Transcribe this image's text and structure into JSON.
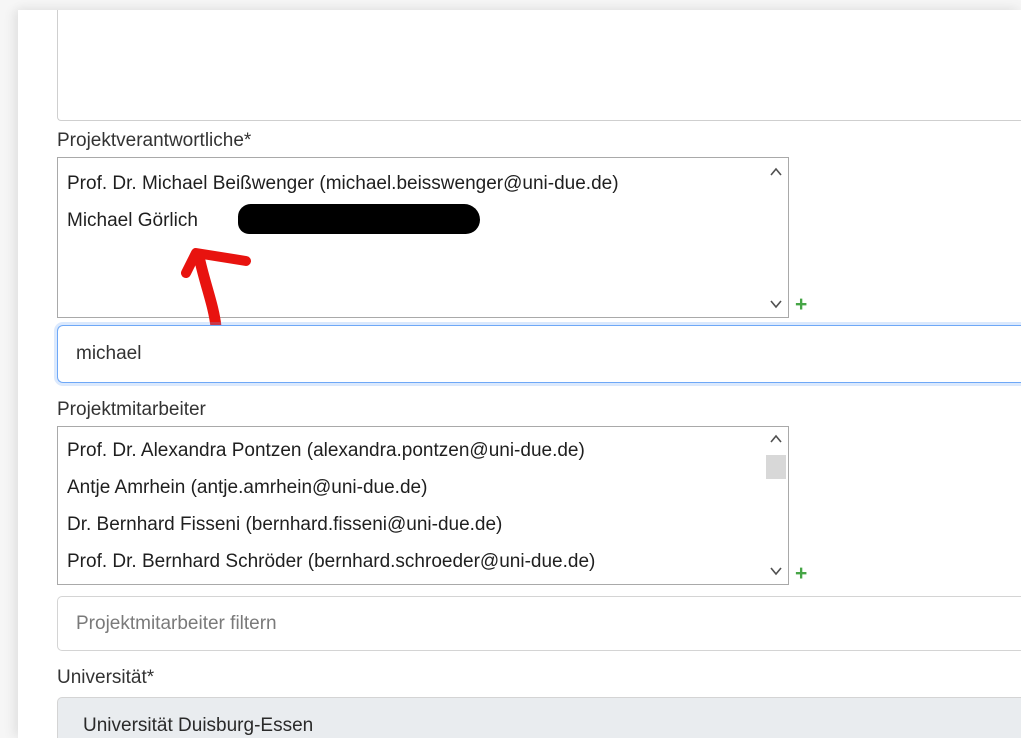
{
  "fields": {
    "verantwortliche": {
      "label": "Projektverantwortliche*",
      "selected": [
        "Prof. Dr. Michael Beißwenger (michael.beisswenger@uni-due.de)",
        "Michael Görlich"
      ],
      "search_value": "michael"
    },
    "mitarbeiter": {
      "label": "Projektmitarbeiter",
      "options": [
        "Prof. Dr. Alexandra Pontzen (alexandra.pontzen@uni-due.de)",
        "Antje Amrhein (antje.amrhein@uni-due.de)",
        "Dr. Bernhard Fisseni (bernhard.fisseni@uni-due.de)",
        "Prof. Dr. Bernhard Schröder (bernhard.schroeder@uni-due.de)"
      ],
      "filter_placeholder": "Projektmitarbeiter filtern"
    },
    "universitaet": {
      "label": "Universität*",
      "value": "Universität Duisburg-Essen"
    }
  },
  "icons": {
    "add": "plus-icon",
    "scroll_up": "chevron-up-icon",
    "scroll_down": "chevron-down-icon"
  },
  "colors": {
    "add_green": "#46a546",
    "focus_blue": "#6ea8f7",
    "annotation_red": "#e8130f"
  }
}
